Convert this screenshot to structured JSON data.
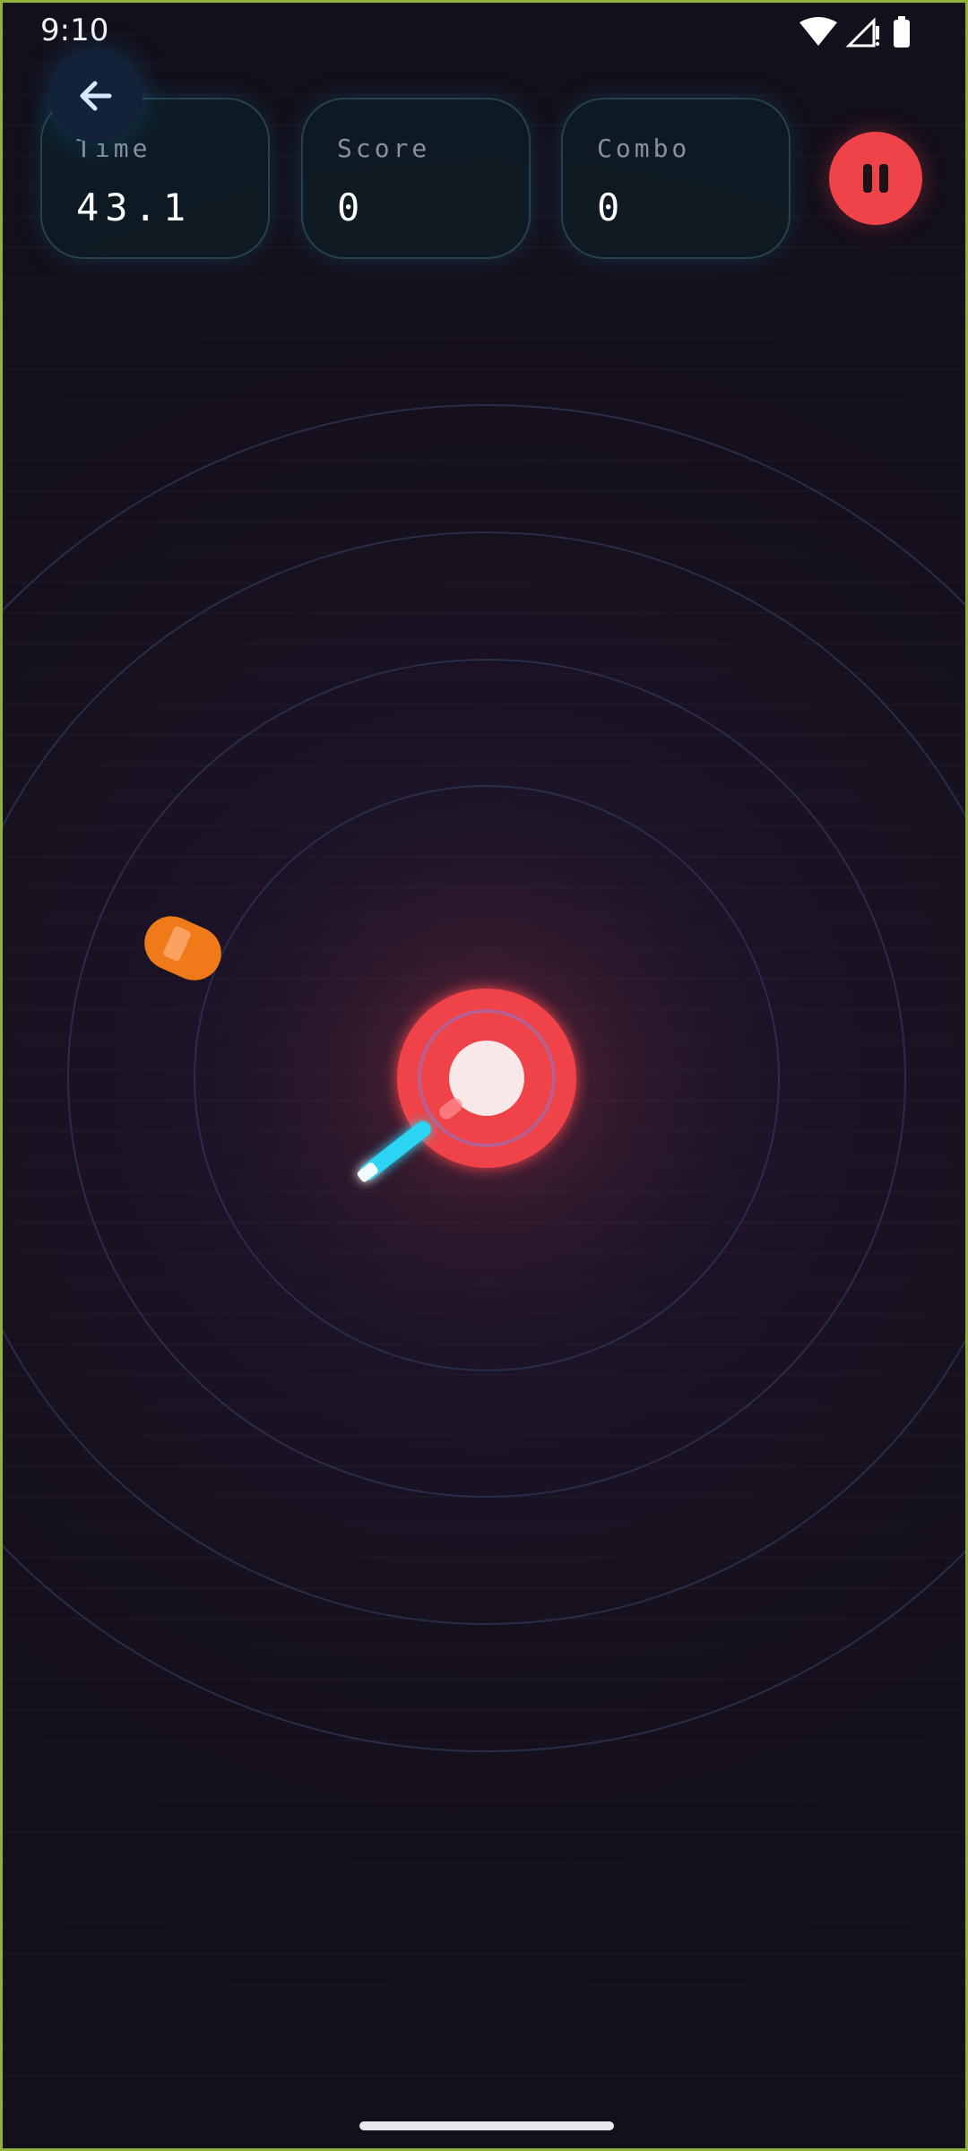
{
  "status_bar": {
    "time": "9:10",
    "icons": [
      "wifi-icon",
      "signal-icon",
      "battery-icon"
    ]
  },
  "hud": {
    "time_label": "Time",
    "time_value": "43.1",
    "score_label": "Score",
    "score_value": "0",
    "combo_label": "Combo",
    "combo_value": "0"
  },
  "controls": {
    "back_icon": "arrow-left-icon",
    "pause_icon": "pause-icon"
  },
  "colors": {
    "background": "#14101f",
    "ring": "#2a2d4a",
    "target_red": "#ef4349",
    "target_core": "#f8e8e8",
    "projectile_cyan": "#2ad4f2",
    "obstacle_orange": "#f07a19",
    "hud_border": "#25424f",
    "hud_label": "#8a8ea0"
  }
}
